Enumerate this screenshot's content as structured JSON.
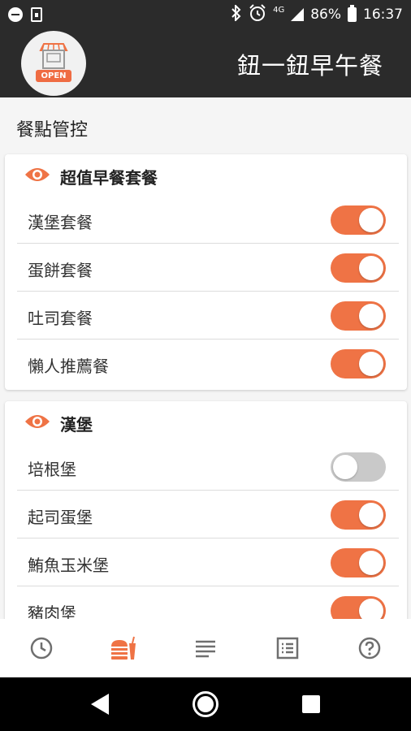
{
  "status_bar": {
    "network_label": "4G",
    "battery": "86%",
    "time": "16:37"
  },
  "app": {
    "logo_text": "OPEN",
    "title": "鈕一鈕早午餐"
  },
  "page": {
    "title": "餐點管控"
  },
  "categories": [
    {
      "name": "超值早餐套餐",
      "items": [
        {
          "label": "漢堡套餐",
          "enabled": true
        },
        {
          "label": "蛋餅套餐",
          "enabled": true
        },
        {
          "label": "吐司套餐",
          "enabled": true
        },
        {
          "label": "懶人推薦餐",
          "enabled": true
        }
      ]
    },
    {
      "name": "漢堡",
      "items": [
        {
          "label": "培根堡",
          "enabled": false
        },
        {
          "label": "起司蛋堡",
          "enabled": true
        },
        {
          "label": "鮪魚玉米堡",
          "enabled": true
        },
        {
          "label": "豬肉堡",
          "enabled": true
        }
      ]
    }
  ],
  "bottom_nav": [
    {
      "icon": "clock-icon",
      "active": false
    },
    {
      "icon": "menu-food-icon",
      "active": true
    },
    {
      "icon": "list-icon",
      "active": false
    },
    {
      "icon": "checklist-icon",
      "active": false
    },
    {
      "icon": "help-icon",
      "active": false
    }
  ],
  "colors": {
    "accent": "#ef7345",
    "header_bg": "#2b2b2b",
    "toggle_off": "#c9c9c9",
    "inactive_icon": "#6f6f6f"
  }
}
